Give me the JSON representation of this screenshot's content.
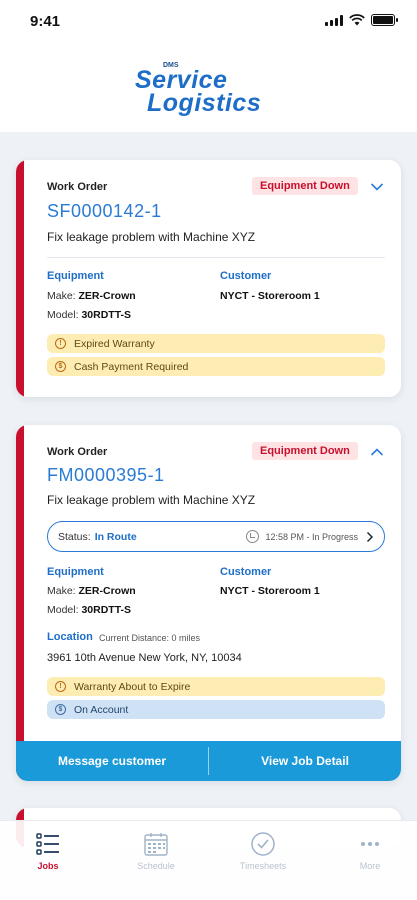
{
  "status_bar": {
    "time": "9:41"
  },
  "logo": {
    "small": "DMS",
    "line1": "Service",
    "line2": "Logistics"
  },
  "colors": {
    "accent_red": "#c8102e",
    "brand_blue": "#1e6ec8",
    "action_blue": "#1a9ad8",
    "warning_yellow": "#fdedb3",
    "info_blue": "#cfe2f5"
  },
  "cards": [
    {
      "label": "Work Order",
      "number": "SF0000142-1",
      "badge": "Equipment Down",
      "description": "Fix leakage problem with Machine XYZ",
      "equipment_label": "Equipment",
      "make_key": "Make:",
      "make_val": "ZER-Crown",
      "model_key": "Model:",
      "model_val": "30RDTT-S",
      "customer_label": "Customer",
      "customer_val": "NYCT - Storeroom 1",
      "alerts": [
        "Expired Warranty",
        "Cash Payment Required"
      ],
      "expanded": false
    },
    {
      "label": "Work Order",
      "number": "FM0000395-1",
      "badge": "Equipment Down",
      "description": "Fix leakage problem with Machine XYZ",
      "status_key": "Status:",
      "status_val": "In Route",
      "status_time": "12:58 PM - In Progress",
      "equipment_label": "Equipment",
      "make_key": "Make:",
      "make_val": "ZER-Crown",
      "model_key": "Model:",
      "model_val": "30RDTT-S",
      "customer_label": "Customer",
      "customer_val": "NYCT - Storeroom 1",
      "location_label": "Location",
      "distance": "Current Distance: 0 miles",
      "address": "3961 10th Avenue New York, NY, 10034",
      "alerts": [
        "Warranty About to Expire",
        "On Account"
      ],
      "actions": [
        "Message customer",
        "View Job Detail"
      ],
      "expanded": true
    }
  ],
  "tabs": [
    {
      "label": "Jobs",
      "icon": "jobs-list-icon",
      "active": true
    },
    {
      "label": "Schedule",
      "icon": "calendar-icon",
      "active": false
    },
    {
      "label": "Timesheets",
      "icon": "clock-icon",
      "active": false
    },
    {
      "label": "More",
      "icon": "more-dots-icon",
      "active": false
    }
  ]
}
